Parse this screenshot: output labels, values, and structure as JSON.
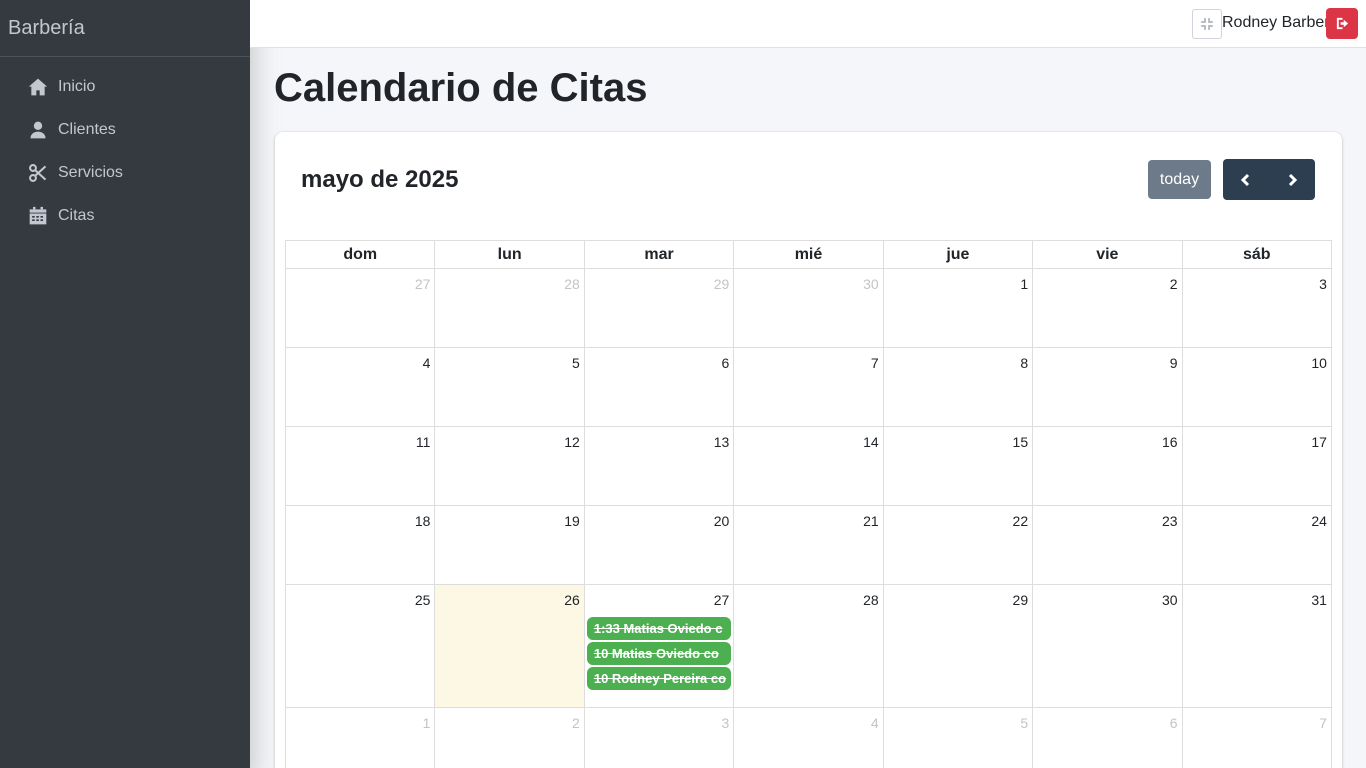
{
  "sidebar": {
    "brand": "Barbería",
    "items": [
      {
        "label": "Inicio",
        "icon": "home-icon"
      },
      {
        "label": "Clientes",
        "icon": "user-icon"
      },
      {
        "label": "Servicios",
        "icon": "scissors-icon"
      },
      {
        "label": "Citas",
        "icon": "calendar-icon"
      }
    ]
  },
  "topbar": {
    "user_name": "Rodney Barber",
    "fullscreen_icon": "compress-icon",
    "logout_icon": "sign-out-icon",
    "logout_color": "#dc3545"
  },
  "page": {
    "title": "Calendario de Citas"
  },
  "calendar": {
    "title": "mayo de 2025",
    "today_label": "today",
    "weekdays": [
      "dom",
      "lun",
      "mar",
      "mié",
      "jue",
      "vie",
      "sáb"
    ],
    "today_date": "26",
    "event_color": "#4caf50",
    "weeks": [
      [
        {
          "d": "27",
          "other": true
        },
        {
          "d": "28",
          "other": true
        },
        {
          "d": "29",
          "other": true
        },
        {
          "d": "30",
          "other": true
        },
        {
          "d": "1"
        },
        {
          "d": "2"
        },
        {
          "d": "3"
        }
      ],
      [
        {
          "d": "4"
        },
        {
          "d": "5"
        },
        {
          "d": "6"
        },
        {
          "d": "7"
        },
        {
          "d": "8"
        },
        {
          "d": "9"
        },
        {
          "d": "10"
        }
      ],
      [
        {
          "d": "11"
        },
        {
          "d": "12"
        },
        {
          "d": "13"
        },
        {
          "d": "14"
        },
        {
          "d": "15"
        },
        {
          "d": "16"
        },
        {
          "d": "17"
        }
      ],
      [
        {
          "d": "18"
        },
        {
          "d": "19"
        },
        {
          "d": "20"
        },
        {
          "d": "21"
        },
        {
          "d": "22"
        },
        {
          "d": "23"
        },
        {
          "d": "24"
        }
      ],
      [
        {
          "d": "25"
        },
        {
          "d": "26",
          "today": true
        },
        {
          "d": "27",
          "events": [
            "1:33 Matias Oviedo c",
            "10 Matias Oviedo co",
            "10 Rodney Pereira co"
          ]
        },
        {
          "d": "28"
        },
        {
          "d": "29"
        },
        {
          "d": "30"
        },
        {
          "d": "31"
        }
      ],
      [
        {
          "d": "1",
          "other": true
        },
        {
          "d": "2",
          "other": true
        },
        {
          "d": "3",
          "other": true
        },
        {
          "d": "4",
          "other": true
        },
        {
          "d": "5",
          "other": true
        },
        {
          "d": "6",
          "other": true
        },
        {
          "d": "7",
          "other": true
        }
      ]
    ]
  }
}
